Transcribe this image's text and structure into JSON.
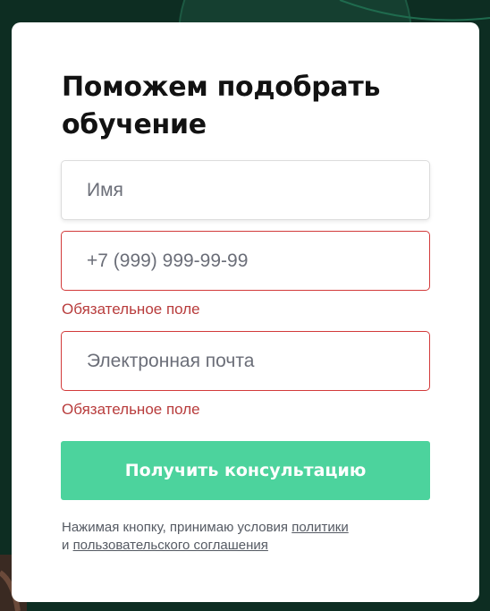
{
  "form": {
    "title": "Поможем подобрать обучение",
    "name_placeholder": "Имя",
    "phone_placeholder": "+7 (999) 999-99-99",
    "phone_error": "Обязательное поле",
    "email_placeholder": "Электронная почта",
    "email_error": "Обязательное поле",
    "submit_label": "Получить консультацию",
    "consent_prefix": "Нажимая кнопку, принимаю условия",
    "consent_link_policy": "политики",
    "consent_and": "и",
    "consent_link_agreement": "пользовательского соглашения"
  },
  "colors": {
    "background": "#0d2d22",
    "accent_button": "#4cd39d",
    "error": "#b83c3c"
  }
}
